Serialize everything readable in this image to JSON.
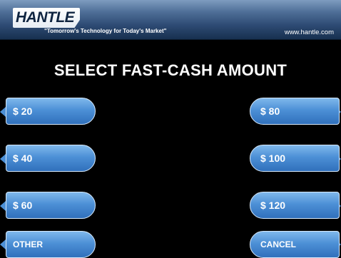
{
  "header": {
    "logo_text": "HANTLE",
    "tagline": "\"Tomorrow's Technology for Today's Market\"",
    "website": "www.hantle.com"
  },
  "title": "SELECT FAST-CASH AMOUNT",
  "buttons": {
    "left": [
      "$ 20",
      "$ 40",
      "$ 60",
      "OTHER"
    ],
    "right": [
      "$ 80",
      "$ 100",
      "$ 120",
      "CANCEL"
    ]
  },
  "colors": {
    "button_fill": "#4d90d6",
    "button_border": "#d6e9fb",
    "header": "#2d4a73",
    "background": "#000000"
  }
}
